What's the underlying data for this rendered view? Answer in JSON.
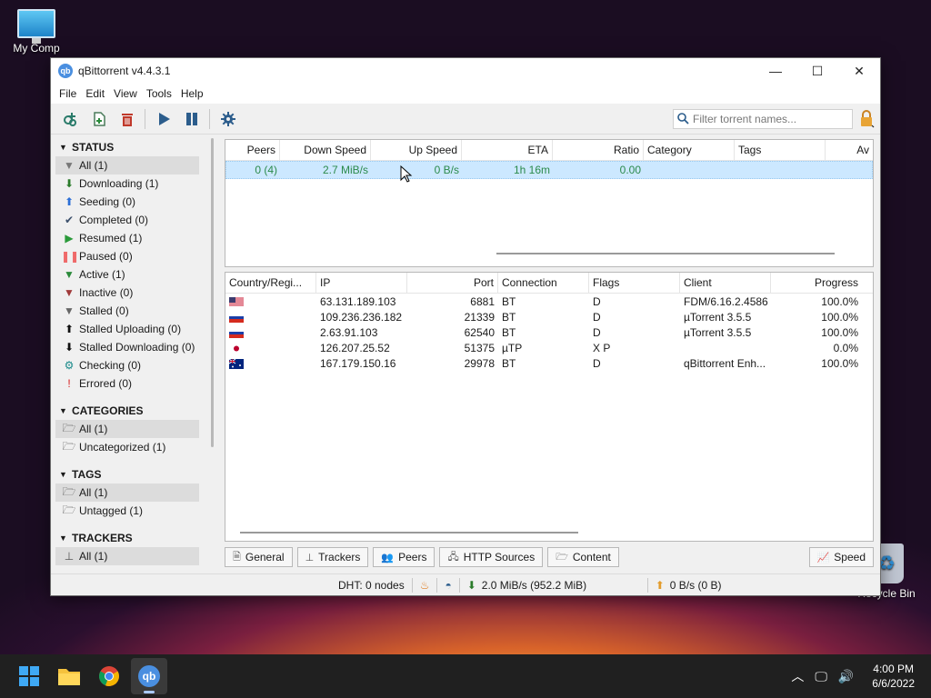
{
  "desktop": {
    "computer_label": "My Comp",
    "recycle_label": "Recycle Bin"
  },
  "window": {
    "app_icon": "qb",
    "title": "qBittorrent v4.4.3.1",
    "minimize": "—",
    "maximize": "☐",
    "close": "✕"
  },
  "menu": [
    "File",
    "Edit",
    "View",
    "Tools",
    "Help"
  ],
  "search": {
    "placeholder": "Filter torrent names..."
  },
  "sidebar": {
    "status_header": "STATUS",
    "status": [
      {
        "label": "All (1)",
        "icon": "filter-icon",
        "glyph": "▼",
        "color": "#777777"
      },
      {
        "label": "Downloading (1)",
        "icon": "arrow-down-icon",
        "glyph": "⬇",
        "color": "#2a7b2a"
      },
      {
        "label": "Seeding (0)",
        "icon": "arrow-up-icon",
        "glyph": "⬆",
        "color": "#2c6fd6"
      },
      {
        "label": "Completed (0)",
        "icon": "check-icon",
        "glyph": "✔",
        "color": "#3b4f6b"
      },
      {
        "label": "Resumed (1)",
        "icon": "play-icon",
        "glyph": "▶",
        "color": "#2a9a3a"
      },
      {
        "label": "Paused (0)",
        "icon": "pause-icon",
        "glyph": "❚❚",
        "color": "#ef6a6a"
      },
      {
        "label": "Active (1)",
        "icon": "filter-active-icon",
        "glyph": "▼",
        "color": "#2a8a3a"
      },
      {
        "label": "Inactive (0)",
        "icon": "filter-inactive-icon",
        "glyph": "▼",
        "color": "#a03a3a"
      },
      {
        "label": "Stalled (0)",
        "icon": "filter-stalled-icon",
        "glyph": "▼",
        "color": "#666666"
      },
      {
        "label": "Stalled Uploading (0)",
        "icon": "stalled-up-icon",
        "glyph": "⬆",
        "color": "#111111"
      },
      {
        "label": "Stalled Downloading (0)",
        "icon": "stalled-down-icon",
        "glyph": "⬇",
        "color": "#111111"
      },
      {
        "label": "Checking (0)",
        "icon": "gear-icon",
        "glyph": "⚙",
        "color": "#1a8a8a"
      },
      {
        "label": "Errored (0)",
        "icon": "error-icon",
        "glyph": "!",
        "color": "#d81e1e"
      }
    ],
    "categories_header": "CATEGORIES",
    "categories": [
      {
        "label": "All (1)"
      },
      {
        "label": "Uncategorized (1)"
      }
    ],
    "tags_header": "TAGS",
    "tags": [
      {
        "label": "All (1)"
      },
      {
        "label": "Untagged (1)"
      }
    ],
    "trackers_header": "TRACKERS",
    "trackers": [
      {
        "label": "All (1)"
      }
    ]
  },
  "torrents": {
    "columns": [
      "Peers",
      "Down Speed",
      "Up Speed",
      "ETA",
      "Ratio",
      "Category",
      "Tags",
      "Av"
    ],
    "rows": [
      {
        "peers": "0 (4)",
        "down": "2.7 MiB/s",
        "up": "0 B/s",
        "eta": "1h 16m",
        "ratio": "0.00",
        "category": "",
        "tags": ""
      }
    ]
  },
  "peers": {
    "columns": [
      "Country/Regi...",
      "IP",
      "Port",
      "Connection",
      "Flags",
      "Client",
      "Progress"
    ],
    "rows": [
      {
        "flag": "us",
        "ip": "63.131.189.103",
        "port": "6881",
        "conn": "BT",
        "flags": "D",
        "client": "FDM/6.16.2.4586",
        "progress": "100.0%"
      },
      {
        "flag": "ru",
        "ip": "109.236.236.182",
        "port": "21339",
        "conn": "BT",
        "flags": "D",
        "client": "µTorrent 3.5.5",
        "progress": "100.0%"
      },
      {
        "flag": "ru",
        "ip": "2.63.91.103",
        "port": "62540",
        "conn": "BT",
        "flags": "D",
        "client": "µTorrent 3.5.5",
        "progress": "100.0%"
      },
      {
        "flag": "jp",
        "ip": "126.207.25.52",
        "port": "51375",
        "conn": "µTP",
        "flags": "X P",
        "client": "",
        "progress": "0.0%"
      },
      {
        "flag": "au",
        "ip": "167.179.150.16",
        "port": "29978",
        "conn": "BT",
        "flags": "D",
        "client": "qBittorrent Enh...",
        "progress": "100.0%"
      }
    ]
  },
  "tabs": [
    "General",
    "Trackers",
    "Peers",
    "HTTP Sources",
    "Content"
  ],
  "speed_tab": "Speed",
  "status": {
    "dht": "DHT: 0 nodes",
    "down": "2.0 MiB/s (952.2 MiB)",
    "up": "0 B/s (0 B)"
  },
  "taskbar": {
    "app_label": "qb",
    "time": "4:00 PM",
    "date": "6/6/2022"
  }
}
